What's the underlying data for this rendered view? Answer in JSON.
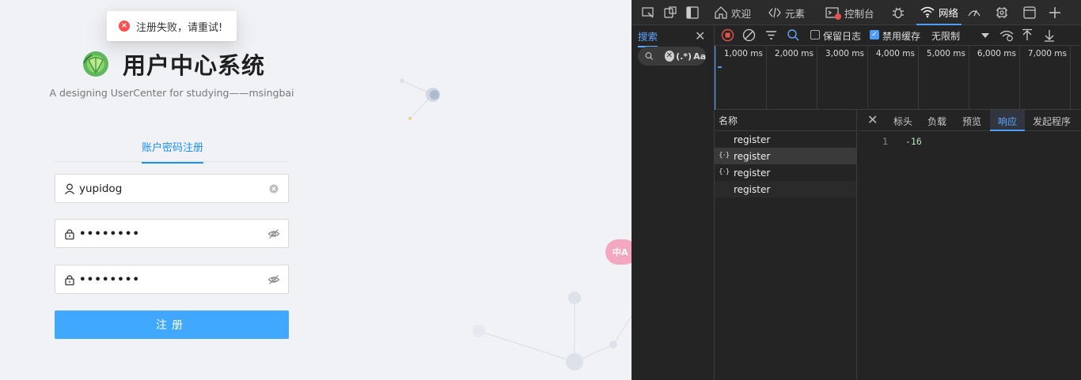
{
  "app": {
    "toast": {
      "icon": "×",
      "text": "注册失败，请重试!"
    },
    "logo_icon": "cabbage-logo-icon",
    "title": "用户中心系统",
    "subtitle": "A designing UserCenter for studying——msingbai",
    "tab_label": "账户密码注册",
    "username_value": "yupidog",
    "password_value": "••••••••",
    "confirm_password_value": "••••••••",
    "submit_label": "注册",
    "translate_fab_label": "中A",
    "colors": {
      "accent": "#1890ff",
      "button": "#40a9ff",
      "error": "#ff4d4f"
    }
  },
  "devtools": {
    "tabs": [
      {
        "label": "欢迎",
        "icon": "home-icon"
      },
      {
        "label": "元素",
        "icon": "code-icon"
      },
      {
        "label": "控制台",
        "icon": "console-icon"
      },
      {
        "label": "网络",
        "icon": "wifi-icon"
      }
    ],
    "search_tab": "搜索",
    "search_regex": "(.*)",
    "search_case": "Aa",
    "toolbar": {
      "preserve_log": "保留日志",
      "disable_cache": "禁用缓存",
      "throttle": "无限制"
    },
    "timeline_ticks": [
      "1,000 ms",
      "2,000 ms",
      "3,000 ms",
      "4,000 ms",
      "5,000 ms",
      "6,000 ms",
      "7,000 ms"
    ],
    "requests_header": "名称",
    "requests": [
      {
        "name": "register",
        "type": "doc"
      },
      {
        "name": "register",
        "type": "fetch"
      },
      {
        "name": "register",
        "type": "fetch"
      },
      {
        "name": "register",
        "type": "doc"
      }
    ],
    "detail_tabs": [
      "标头",
      "负载",
      "预览",
      "响应",
      "发起程序"
    ],
    "active_detail_tab": "响应",
    "response": {
      "line": "1",
      "value": "-16"
    }
  }
}
